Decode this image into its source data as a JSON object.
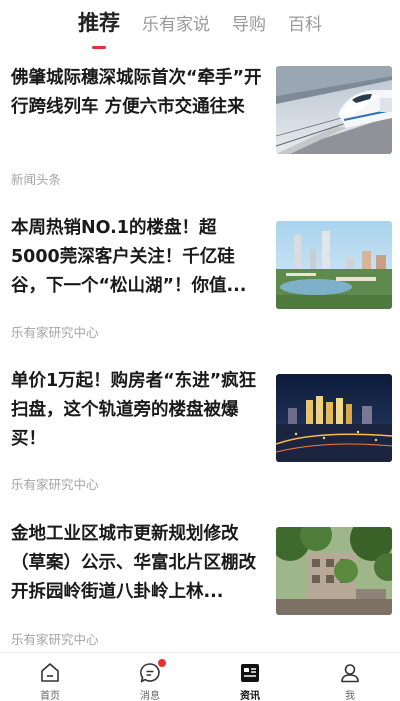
{
  "tabs": [
    {
      "label": "推荐",
      "active": true
    },
    {
      "label": "乐有家说",
      "active": false
    },
    {
      "label": "导购",
      "active": false
    },
    {
      "label": "百科",
      "active": false
    }
  ],
  "articles": [
    {
      "title": "佛肇城际穗深城际首次“牵手”开行跨线列车 方便六市交通往来",
      "source": "新闻头条",
      "image": "high-speed-train-photo"
    },
    {
      "title": "本周热销NO.1的楼盘！超5000莞深客户关注！千亿硅谷，下一个“松山湖”！你值...",
      "source": "乐有家研究中心",
      "image": "city-skyline-aerial-photo"
    },
    {
      "title": "单价1万起！购房者“东进”疯狂扫盘，这个轨道旁的楼盘被爆买！",
      "source": "乐有家研究中心",
      "image": "night-city-skyline-photo"
    },
    {
      "title": "金地工业区城市更新规划修改（草案）公示、华富北片区棚改开拆园岭街道八卦岭上林...",
      "source": "乐有家研究中心",
      "image": "old-building-trees-photo"
    }
  ],
  "bottom_nav": [
    {
      "label": "首页",
      "icon": "home-icon",
      "active": false,
      "badge": false
    },
    {
      "label": "消息",
      "icon": "message-icon",
      "active": false,
      "badge": true
    },
    {
      "label": "资讯",
      "icon": "news-icon",
      "active": true,
      "badge": false
    },
    {
      "label": "我",
      "icon": "profile-icon",
      "active": false,
      "badge": false
    }
  ],
  "colors": {
    "accent": "#e8312f",
    "title_text": "#1a1a1a",
    "muted_text": "#a5a5a5",
    "inactive_tab": "#999999"
  }
}
